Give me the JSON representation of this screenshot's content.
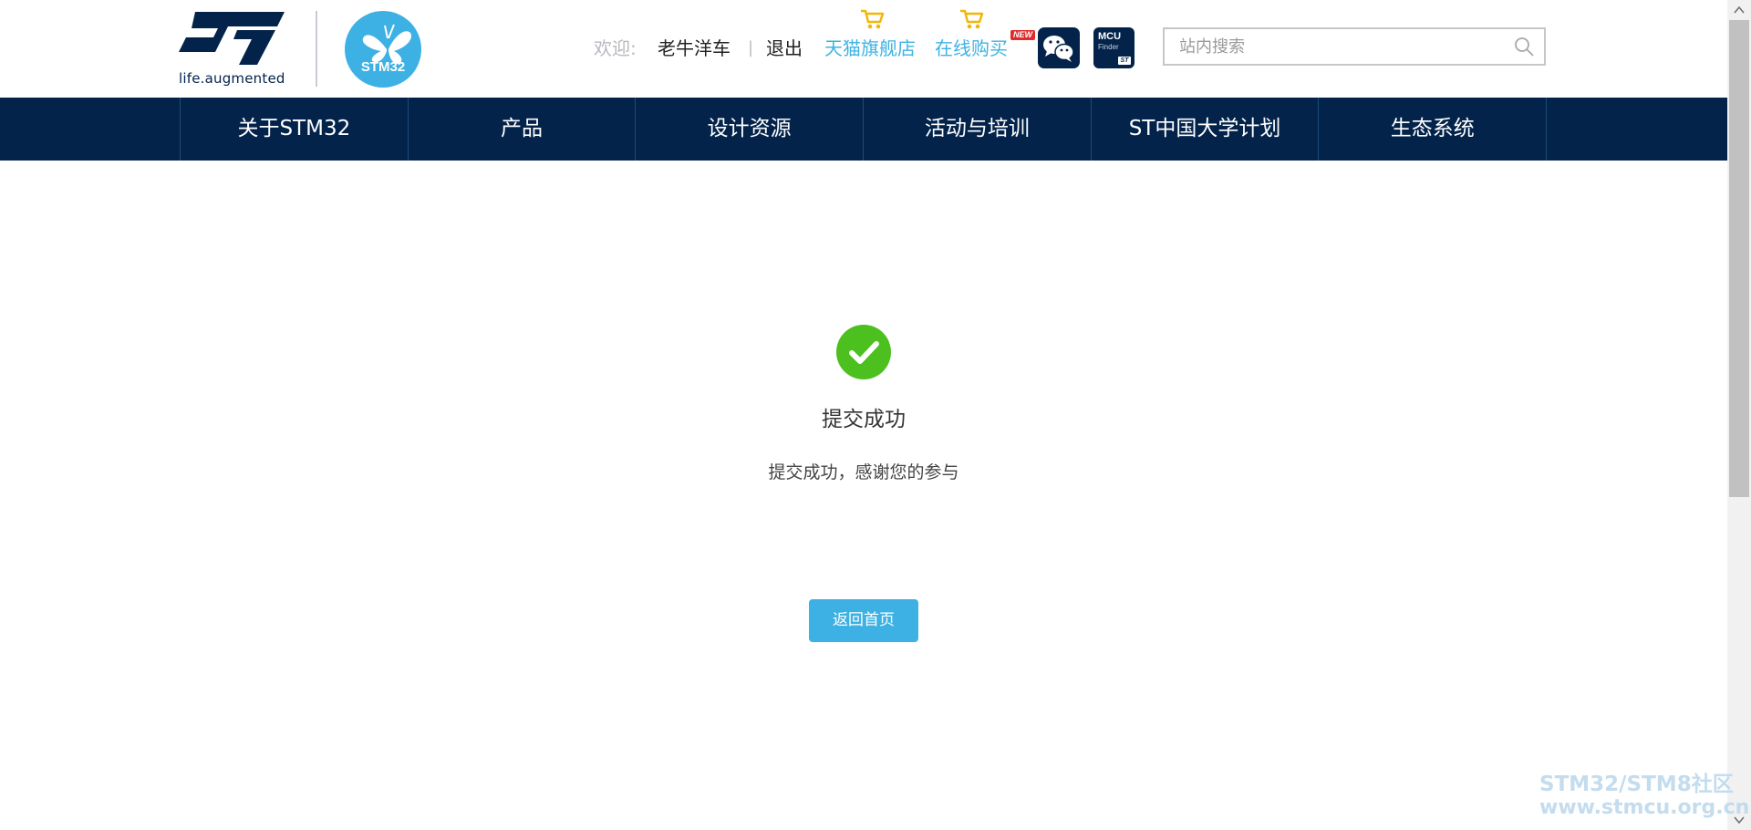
{
  "header": {
    "logo_tagline": "life.augmented",
    "stm32_logo_text": "STM32",
    "welcome_label": "欢迎:",
    "username": "老牛洋车",
    "separator": "|",
    "logout_label": "退出",
    "tmall_label": "天猫旗舰店",
    "buy_online_label": "在线购买",
    "new_badge": "NEW",
    "mcu_finder_line1": "MCU",
    "mcu_finder_line2": "Finder",
    "mcu_finder_st": "ST",
    "search": {
      "placeholder": "站内搜索",
      "value": ""
    },
    "colors": {
      "brand_navy": "#03234b",
      "accent_blue": "#3fb2e3"
    }
  },
  "nav": {
    "items": [
      {
        "label": "关于STM32"
      },
      {
        "label": "产品"
      },
      {
        "label": "设计资源"
      },
      {
        "label": "活动与培训"
      },
      {
        "label": "ST中国大学计划"
      },
      {
        "label": "生态系统"
      }
    ]
  },
  "main": {
    "title": "提交成功",
    "message": "提交成功，感谢您的参与",
    "home_button_label": "返回首页",
    "colors": {
      "success_green": "#4cc01f",
      "button_blue": "#3db1e3"
    }
  },
  "watermark": {
    "line1": "STM32/STM8社区",
    "line2": "www.stmcu.org.cn"
  }
}
